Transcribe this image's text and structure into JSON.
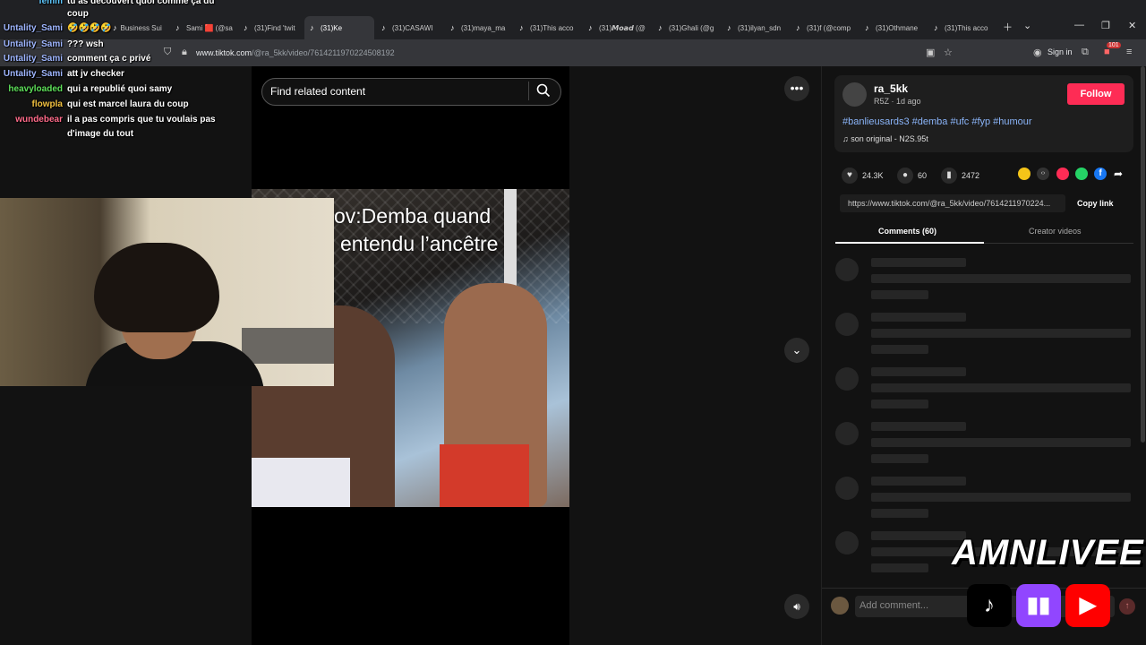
{
  "browser": {
    "tabs": [
      {
        "label": "Business Suit"
      },
      {
        "label": "Sami 🟥 (@sa"
      },
      {
        "label": "(31)Find 'twit"
      },
      {
        "label": "(31)Ke",
        "active": true
      },
      {
        "label": "(31)CASAWI"
      },
      {
        "label": "(31)maya_ma"
      },
      {
        "label": "(31)This acco"
      },
      {
        "label": "(31)𝙈𝙤𝙖𝙙 (@"
      },
      {
        "label": "(31)Ghali (@g"
      },
      {
        "label": "(31)ilyan_sdn"
      },
      {
        "label": "(31)f (@comp"
      },
      {
        "label": "(31)Othmane"
      },
      {
        "label": "(31)This acco"
      }
    ],
    "url_domain": "www.tiktok.com",
    "url_path": "/@ra_5kk/video/7614211970224508192",
    "sign_in": "Sign in",
    "ext_badge": "101"
  },
  "chat": [
    {
      "user": "femm",
      "msg": "tu as découvert quoi comme ça du",
      "color": "#5ec8ff"
    },
    {
      "user": "",
      "msg": "coup",
      "color": "#fff"
    },
    {
      "user": "Untality_Sami",
      "msg": "🤣🤣🤣🤣",
      "color": "#9fb6ff"
    },
    {
      "user": "Untality_Sami",
      "msg": "??? wsh",
      "color": "#9fb6ff"
    },
    {
      "user": "Untality_Sami",
      "msg": "comment ça c privé",
      "color": "#9fb6ff"
    },
    {
      "user": "Untality_Sami",
      "msg": "att jv checker",
      "color": "#9fb6ff"
    },
    {
      "user": "heavyloaded",
      "msg": "qui a republié quoi samy",
      "color": "#5ee05a"
    },
    {
      "user": "flowpla",
      "msg": "qui est marcel laura du coup",
      "color": "#f0c040"
    },
    {
      "user": "wundebear",
      "msg": "il a pas compris que tu voulais pas",
      "color": "#ff6b8a"
    },
    {
      "user": "",
      "msg": "d'image du tout",
      "color": "#fff"
    }
  ],
  "search": {
    "placeholder": "Find related content"
  },
  "video": {
    "caption_line1": "ov:Demba quand",
    "caption_line2": "entendu l’ancêtre"
  },
  "post": {
    "username": "ra_5kk",
    "subline": "R5Z · 1d ago",
    "follow": "Follow",
    "hashtags": "#banlieusards3 #demba #ufc #fyp #humour",
    "sound": "son original - N2S.95t",
    "likes": "24.3K",
    "comments": "60",
    "saves": "2472",
    "link": "https://www.tiktok.com/@ra_5kk/video/7614211970224...",
    "copy_link": "Copy link"
  },
  "tabs": {
    "comments": "Comments (60)",
    "creator": "Creator videos"
  },
  "comment_input": {
    "placeholder": "Add comment..."
  },
  "overlay": {
    "brand": "AMNLIVEE"
  },
  "colors": {
    "accent": "#fe2c55",
    "tag": "#8ab4f8",
    "twitch": "#9146ff",
    "youtube": "#ff0000"
  }
}
